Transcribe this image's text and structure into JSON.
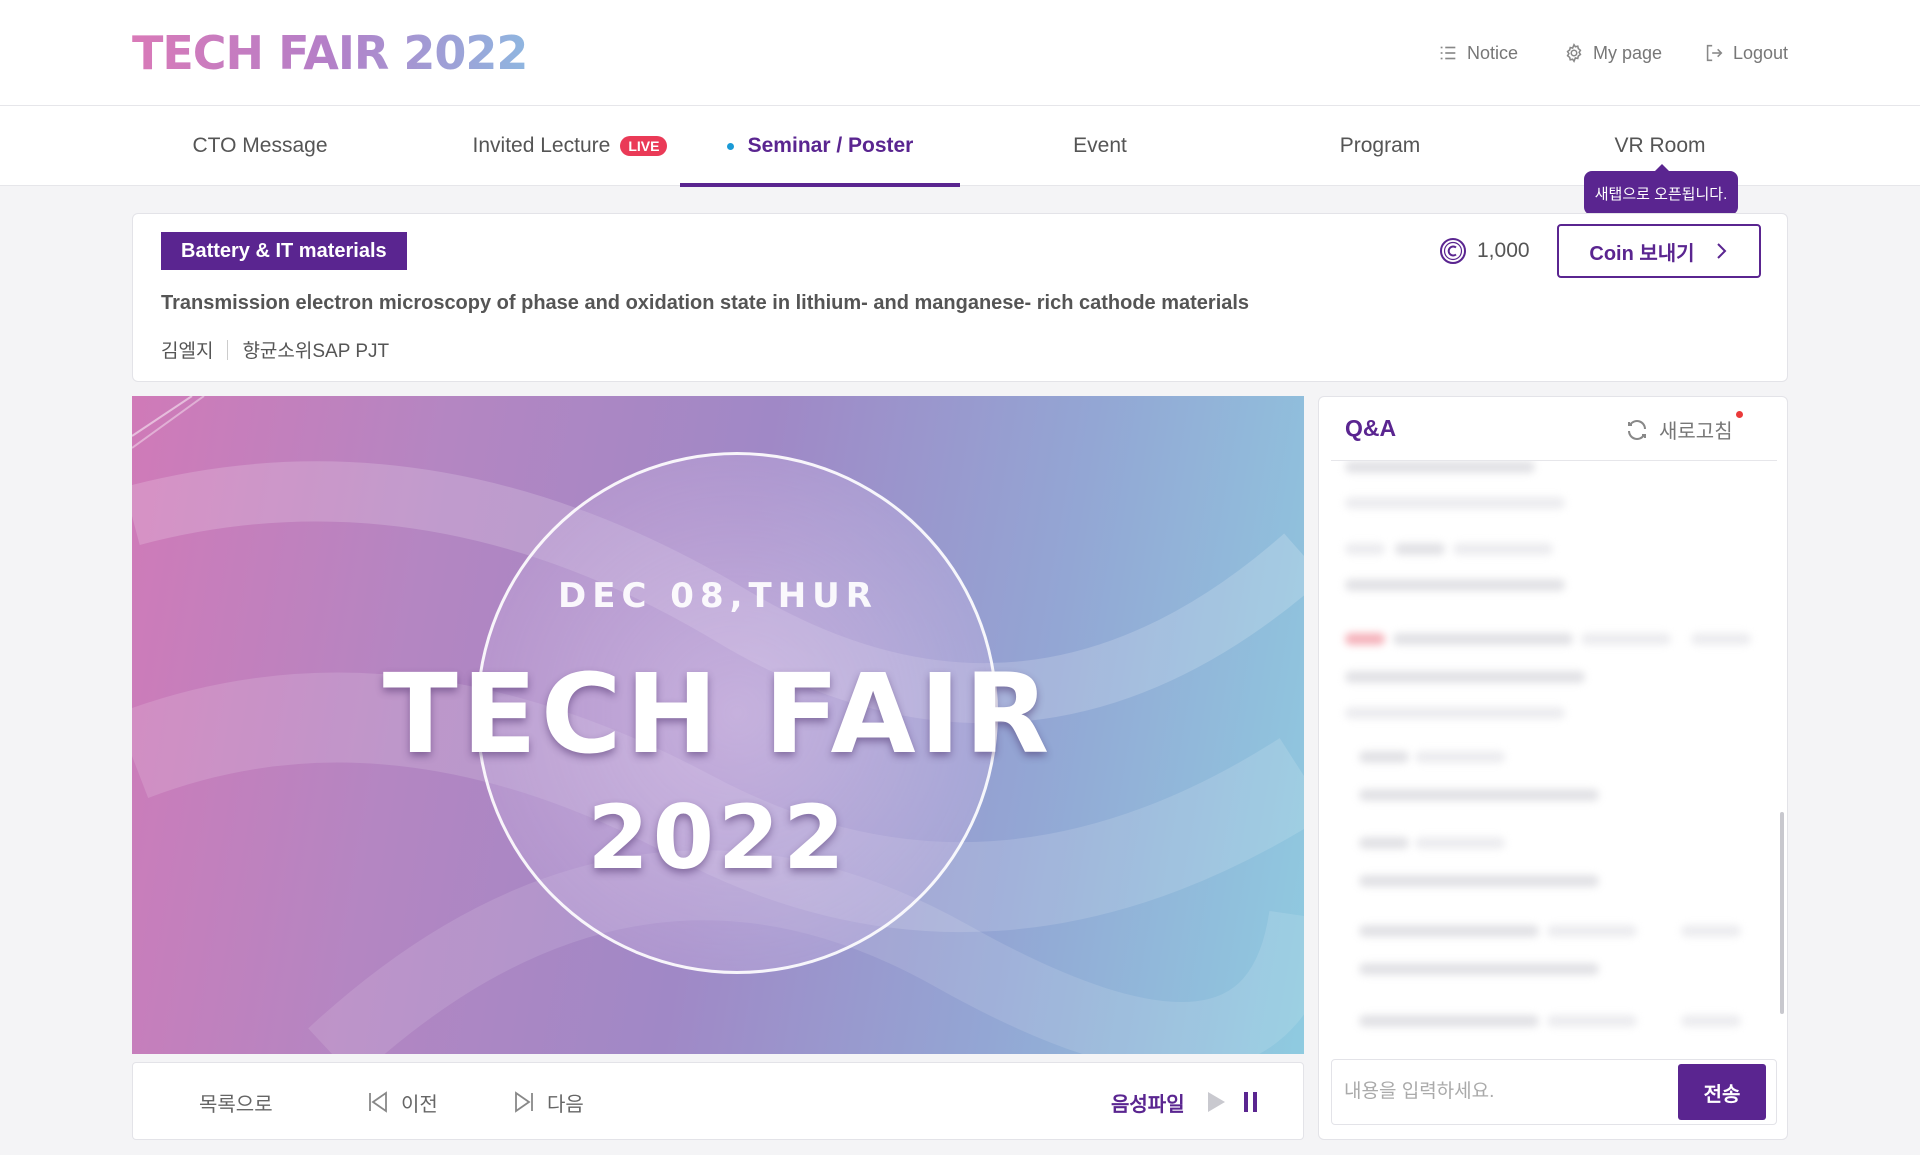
{
  "header": {
    "logo": "TECH FAIR 2022",
    "notice": "Notice",
    "mypage": "My page",
    "logout": "Logout"
  },
  "tabs": [
    {
      "label": "CTO Message"
    },
    {
      "label": "Invited Lecture",
      "badge": "LIVE"
    },
    {
      "label": "Seminar / Poster",
      "active": true
    },
    {
      "label": "Event"
    },
    {
      "label": "Program"
    },
    {
      "label": "VR Room"
    }
  ],
  "tooltip": "새탭으로 오픈됩니다.",
  "session": {
    "category": "Battery & IT materials",
    "coin_count": "1,000",
    "coin_button": "Coin 보내기",
    "title": "Transmission electron microscopy of phase and oxidation state in lithium- and manganese- rich cathode materials",
    "author": "김엘지",
    "affiliation": "향균소위SAP PJT"
  },
  "video": {
    "date": "DEC 08,THUR",
    "title": "TECH FAIR",
    "year": "2022"
  },
  "controls": {
    "list": "목록으로",
    "prev": "이전",
    "next": "다음",
    "audio": "음성파일"
  },
  "qa": {
    "title": "Q&A",
    "refresh": "새로고침",
    "input_placeholder": "내용을 입력하세요.",
    "send": "전송"
  },
  "colors": {
    "brand": "#5a2590",
    "live": "#ea3a57",
    "active_dot": "#1a9ad6"
  }
}
